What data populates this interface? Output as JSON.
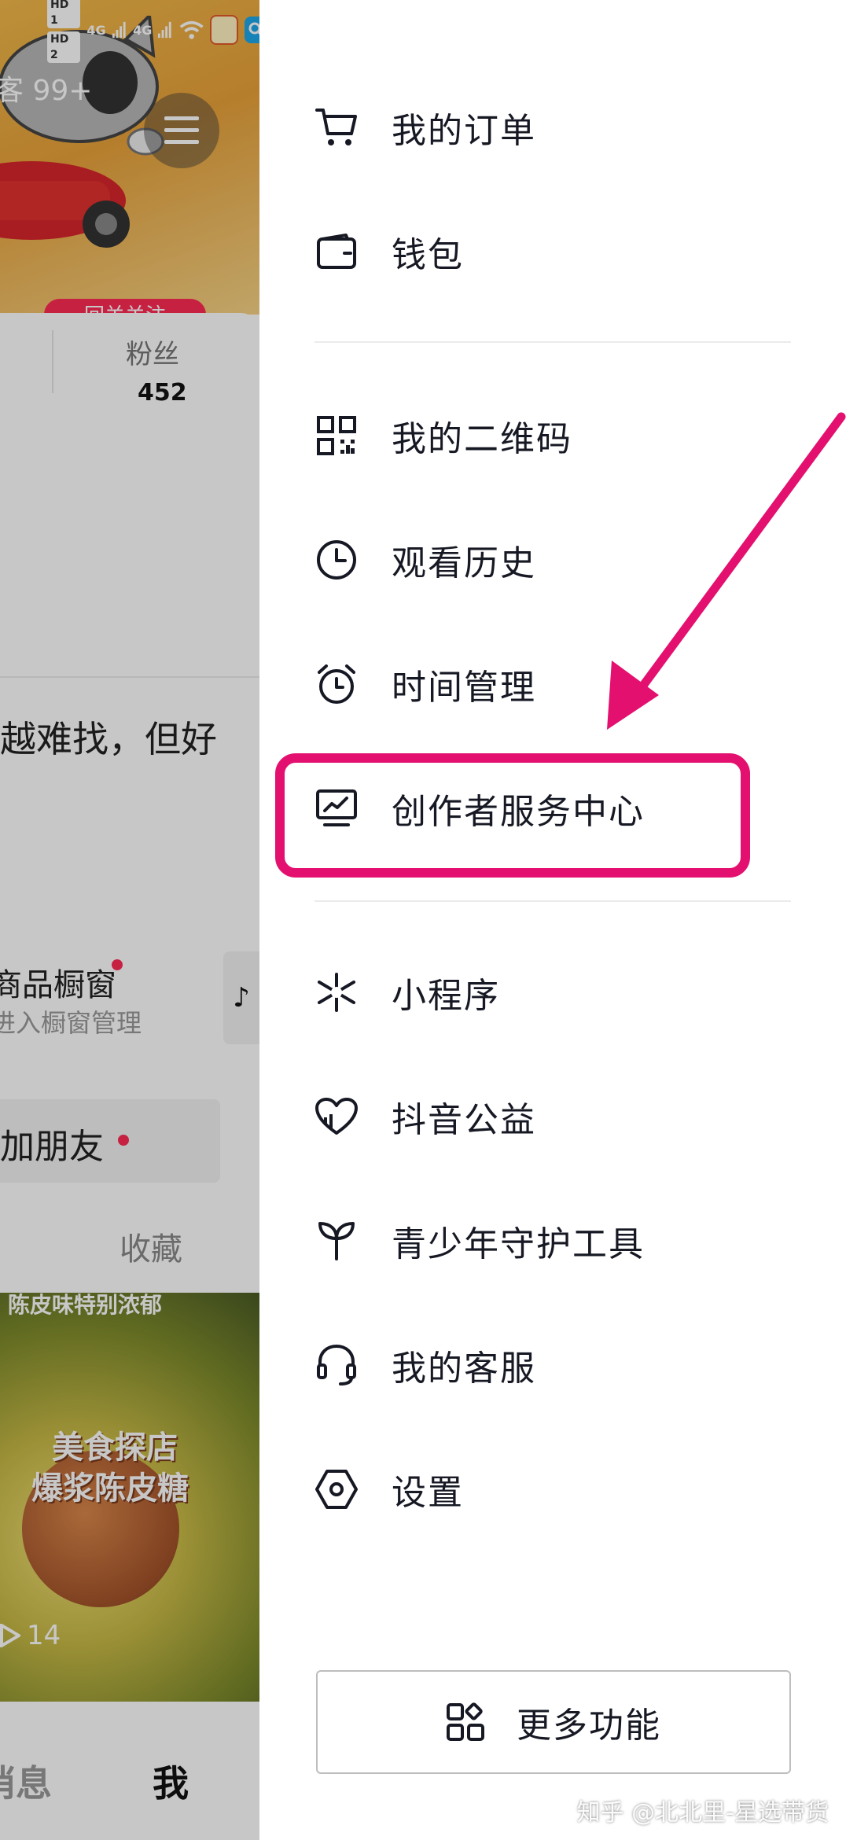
{
  "background": {
    "notification_badge": "客 99+",
    "follow_button": "回关关注",
    "fans": {
      "label": "粉丝",
      "value": "452"
    },
    "bio_fragment": "越难找，但好",
    "shop_window": {
      "title": "商品橱窗",
      "subtitle": "进入橱窗管理"
    },
    "add_friend": "加朋友",
    "favorites_tab": "收藏",
    "video_overlay": {
      "line1": "美食探店",
      "line2": "爆浆陈皮糖",
      "top": "陈皮味特别浓郁"
    },
    "play_count": "14",
    "bottom_nav": {
      "messages": "消息",
      "me": "我"
    },
    "status_bar": {
      "hd1": "HD 1",
      "hd2": "HD 2",
      "net1": "4G",
      "net2": "4G"
    }
  },
  "drawer": {
    "items_group1": [
      {
        "label": "我的订单",
        "icon": "cart-icon"
      },
      {
        "label": "钱包",
        "icon": "wallet-icon"
      }
    ],
    "items_group2": [
      {
        "label": "我的二维码",
        "icon": "qr-code-icon"
      },
      {
        "label": "观看历史",
        "icon": "clock-icon"
      },
      {
        "label": "时间管理",
        "icon": "alarm-clock-icon"
      },
      {
        "label": "创作者服务中心",
        "icon": "creator-chart-icon"
      }
    ],
    "items_group3": [
      {
        "label": "小程序",
        "icon": "mini-program-icon"
      },
      {
        "label": "抖音公益",
        "icon": "charity-heart-icon"
      },
      {
        "label": "青少年守护工具",
        "icon": "sprout-icon"
      },
      {
        "label": "我的客服",
        "icon": "headset-icon"
      },
      {
        "label": "设置",
        "icon": "settings-hexagon-icon"
      }
    ],
    "more_functions": "更多功能",
    "highlight_color": "#e3106f"
  },
  "watermark": "知乎 @北北里-星选带货"
}
